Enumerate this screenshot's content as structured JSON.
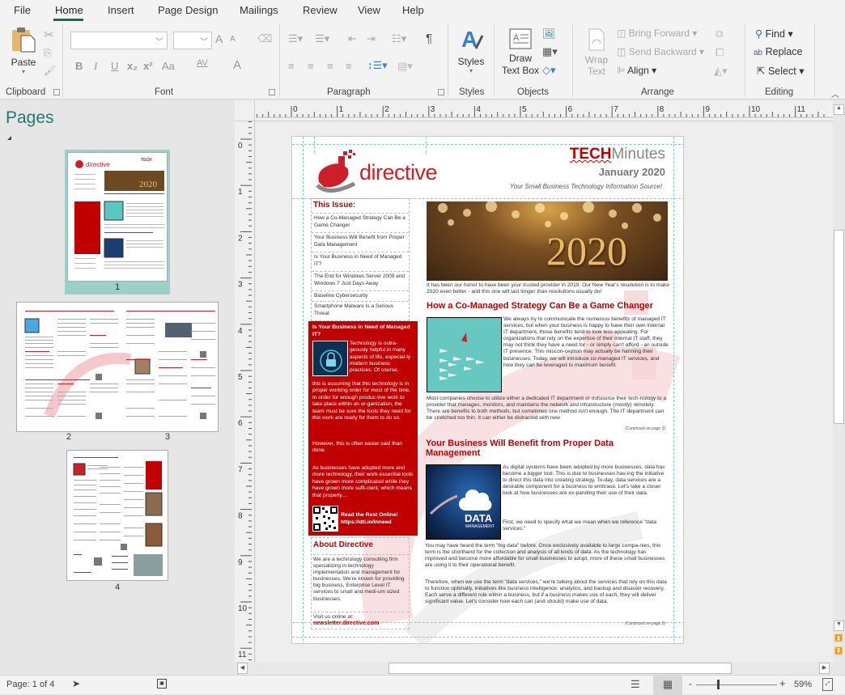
{
  "menu": {
    "items": [
      "File",
      "Home",
      "Insert",
      "Page Design",
      "Mailings",
      "Review",
      "View",
      "Help"
    ],
    "active": "Home"
  },
  "ribbon": {
    "clipboard": {
      "paste": "Paste",
      "label": "Clipboard"
    },
    "font": {
      "label": "Font",
      "font_name": "",
      "font_size": "",
      "bold": "B",
      "italic": "I",
      "underline": "U",
      "subscript": "x₂",
      "superscript": "x²",
      "change_case": "Aa",
      "spacing": "AV",
      "font_color": "A",
      "grow": "A",
      "shrink": "A"
    },
    "paragraph": {
      "label": "Paragraph",
      "pilcrow": "¶"
    },
    "styles": {
      "button": "Styles",
      "label": "Styles"
    },
    "objects": {
      "draw_text_box_1": "Draw",
      "draw_text_box_2": "Text Box",
      "label": "Objects"
    },
    "arrange": {
      "wrap_1": "Wrap",
      "wrap_2": "Text",
      "bring_forward": "Bring Forward",
      "send_backward": "Send Backward",
      "align": "Align",
      "label": "Arrange"
    },
    "editing": {
      "find": "Find",
      "replace": "Replace",
      "select": "Select",
      "label": "Editing"
    }
  },
  "pages_pane": {
    "title": "Pages",
    "thumbnails": [
      {
        "label": "1",
        "selected": true
      },
      {
        "label": "2",
        "selected": false
      },
      {
        "label": "3",
        "selected": false
      },
      {
        "label": "4",
        "selected": false
      }
    ]
  },
  "rulers": {
    "horizontal": [
      "0",
      "1",
      "2",
      "3",
      "4",
      "5",
      "6",
      "7",
      "8",
      "9",
      "10",
      "11"
    ],
    "vertical": [
      "0",
      "1",
      "2",
      "3",
      "4",
      "5",
      "6",
      "7",
      "8",
      "9",
      "10",
      "11"
    ]
  },
  "newsletter": {
    "brand": "directive",
    "masthead_tech": "TECH",
    "masthead_minutes": "Minutes",
    "issue_date": "January 2020",
    "tagline": "Your Small Business Technology Information Source!",
    "this_issue_title": "This Issue:",
    "toc": [
      "How a Co-Managed Strategy Can Be a Game Changer",
      "Your Business Will Benefit from Proper Data Management",
      "Is Your Business in Need of Managed IT?",
      "The End for Windows Server 2008 and Windows 7 Just Days Away",
      "Baseline Cybersecurity",
      "Smartphone Malware Is a Serious Threat"
    ],
    "sidebar_article": {
      "title": "Is Your Business in Need of Managed IT?",
      "p1_wrap": "Technology is outra-geously helpful in many aspects of life, especial-ly modern business practices. Of course,",
      "p1_rest": "this is assuming that this technology is in proper working order for most of the time. In order for enough produc-tive work to take place within an or-ganization, the team must be sure the tools they need for this work are ready for them to do so.",
      "p2": "However, this is often easier said than done.",
      "p3": "As businesses have adopted more and more technology, their work-essential tools have grown more complicated while they have grown more suffi-cient, which means that properly…",
      "read_more": "Read the Rest Online!",
      "link": "https://dti.io/inneed"
    },
    "about": {
      "title": "About Directive",
      "body": "We are a technology consulting firm specializing in technology implementation and management for businesses. We're known for providing big business, Enterprise Level IT services to small and medi-um sized businesses.",
      "visit": "Visit us online at:",
      "url": "newsletter.directive.com"
    },
    "hero_text": "2020",
    "intro": "It has been our honor to have been your trusted provider in 2019. Our New Year's resolution is to make 2020 even better - and this one will last longer than resolutions usually do!",
    "article1": {
      "title": "How a Co-Managed Strategy Can Be a Game Changer",
      "wrap": "We always try to communicate the numerous benefits of managed IT services, but when your business is happy to have their own internal IT department, those benefits tend to look less appealing. For organizations that rely on the expertise of their internal IT staff, they may not think they have a need for - or simply can't afford - an outside IT presence. This miscon-ception may actually be harming their businesses. Today, we will introduce co-managed IT services, and how they can be leveraged to maximum benefit.",
      "body": "Most companies choose to utilize either a dedicated IT department or outsource their tech-nology to a provider that manages, monitors, and maintains the network and infrastructure (mostly) remotely. There are benefits to both methods, but sometimes one method isn't enough. The IT department can be stretched too thin. It can either be distracted with new",
      "continued": "(Continued on page 3)"
    },
    "article2": {
      "title": "Your Business Will Benefit from Proper Data Management",
      "wrap1": "As digital systems have been adopted by more businesses, data has become a bigger tool. This is due to businesses hav-ing the initiative to direct this data into creating strategy. To-day, data services are a desirable component for a business to embrace. Let's take a closer look at how businesses are ex-panding their use of their data.",
      "wrap2": "First, we need to specify what we mean when we reference \"data services.\"",
      "p3": "You may have heard the term \"big data\" before. Once exclusively available to large compa-nies, this term is the shorthand for the collection and analysis of all kinds of data. As the technology has improved and become more affordable for small businesses to adopt, more of these small businesses are using it to their operational benefit.",
      "p4": "Therefore, when we use the term \"data services,\" we're talking about the services that rely on this data to function optimally, initiatives like business intelligence, analytics, and backup and disaster recovery. Each serve a different role within a business, but if a business makes use of each, they will deliver significant value. Let's consider how each can (and should) make use of data.",
      "image_label": "DATA",
      "image_sublabel": "MANAGEMENT",
      "continued": "(Continued on page 2)"
    }
  },
  "status": {
    "page": "Page: 1 of 4",
    "zoom": "59%",
    "zoom_minus": "-",
    "zoom_plus": "+",
    "zoom_fraction": 0.59
  },
  "colors": {
    "accent": "#0e6e5c",
    "brand_red": "#c00000",
    "pages_title": "#217a72",
    "thumb_selected": "#9ccfc8"
  }
}
